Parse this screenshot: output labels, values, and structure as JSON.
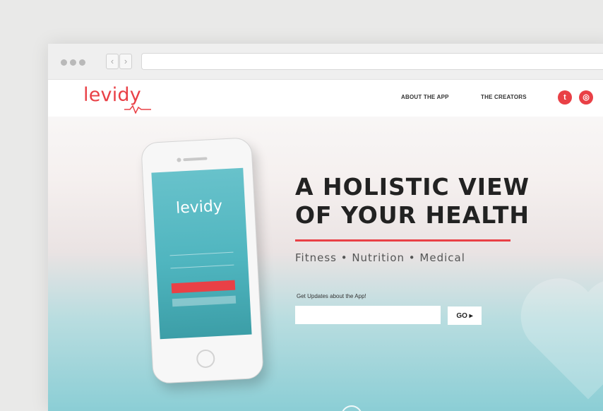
{
  "brand": {
    "name": "levidy",
    "accent": "#e94046",
    "teal": "#5dbcc7"
  },
  "nav": {
    "links": [
      "ABOUT THE APP",
      "THE CREATORS"
    ],
    "social_icons": [
      "twitter-icon",
      "instagram-icon"
    ]
  },
  "hero": {
    "title_line1": "A HOLISTIC VIEW",
    "title_line2": "OF YOUR HEALTH",
    "subtitle": "Fitness • Nutrition • Medical"
  },
  "signup": {
    "label": "Get Updates about the App!",
    "input_value": "",
    "go_label": "GO ▸"
  },
  "phone": {
    "screen_logo": "levidy"
  },
  "icons": {
    "scroll": "chevrons-down-icon"
  }
}
